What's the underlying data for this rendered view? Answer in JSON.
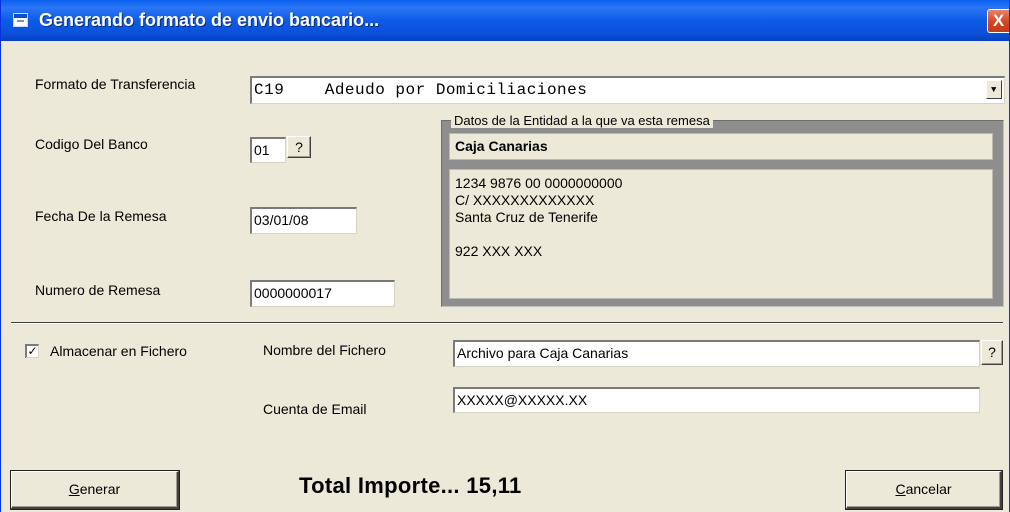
{
  "window": {
    "title": "Generando formato de envio bancario...",
    "close_label": "X"
  },
  "form": {
    "formato_label": "Formato de Transferencia",
    "formato_value": "C19    Adeudo por Domiciliaciones",
    "dropdown_arrow": "▼",
    "codigo_label": "Codigo Del Banco",
    "codigo_value": "01",
    "codigo_help": "?",
    "fecha_label": "Fecha De la Remesa",
    "fecha_value": "03/01/08",
    "numero_label": "Numero de Remesa",
    "numero_value": "0000000017"
  },
  "entity": {
    "group_title": "Datos de la Entidad a la que va esta remesa",
    "bank_name": "Caja Canarias",
    "account": "1234 9876 00 0000000000",
    "address": "C/ XXXXXXXXXXXXX",
    "city": "Santa Cruz de Tenerife",
    "phone": "922 XXX XXX"
  },
  "file": {
    "checkbox_checked": true,
    "checkbox_mark": "✓",
    "checkbox_label": "Almacenar en Fichero",
    "nombre_label": "Nombre del Fichero",
    "nombre_value": "Archivo para Caja Canarias",
    "nombre_help": "?",
    "email_label": "Cuenta de Email",
    "email_value": "XXXXX@XXXXX.XX"
  },
  "footer": {
    "generar_first": "G",
    "generar_rest": "enerar",
    "total_text": "Total Importe... 15,11",
    "cancelar_first": "C",
    "cancelar_rest": "ancelar"
  }
}
